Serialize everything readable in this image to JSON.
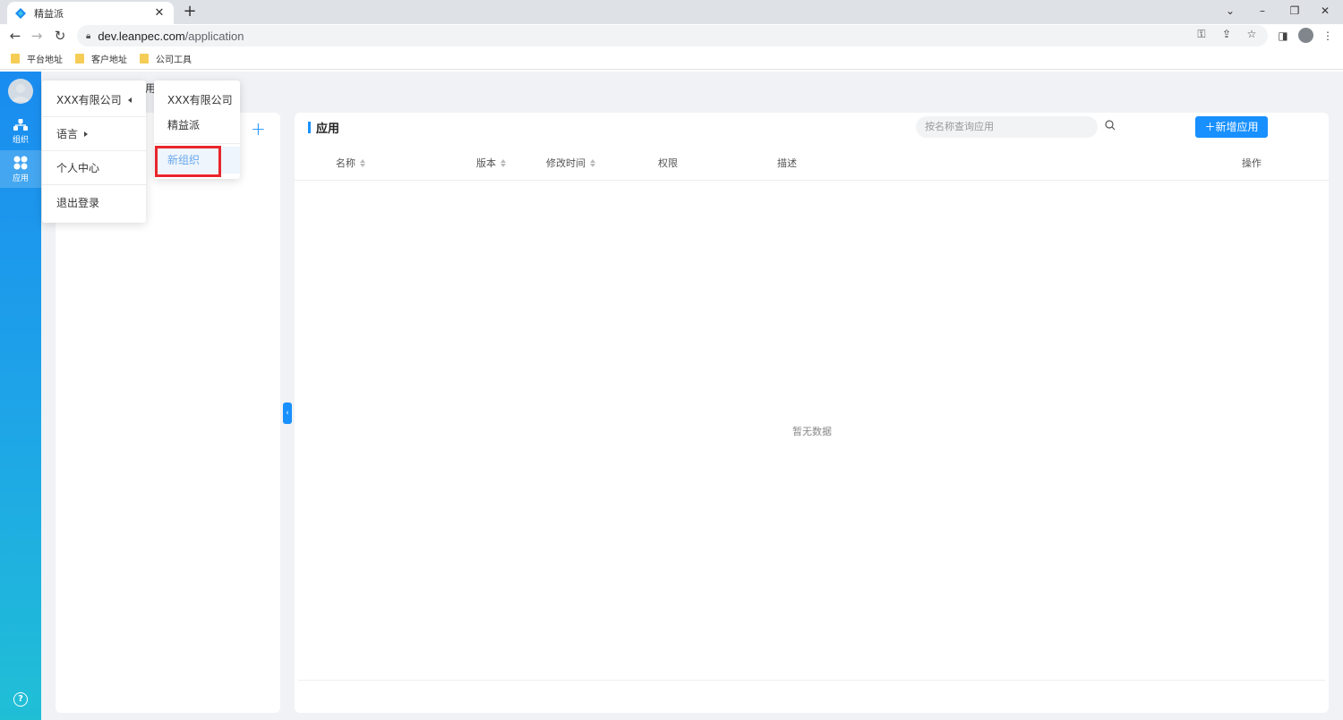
{
  "browser": {
    "tab_title": "精益派",
    "url_host": "dev.leanpec.com",
    "url_path": "/application",
    "bookmarks": [
      "平台地址",
      "客户地址",
      "公司工具"
    ]
  },
  "sidenav": {
    "items": [
      {
        "label": "组织",
        "icon": "org-tree-icon"
      },
      {
        "label": "应用",
        "icon": "apps-icon"
      }
    ],
    "help_icon": "?"
  },
  "org_panel": {
    "peek_text": "用",
    "add_icon": "+"
  },
  "main": {
    "title": "应用",
    "search_placeholder": "按名称查询应用",
    "add_button": "＋新增应用",
    "columns": [
      {
        "label": "名称",
        "sortable": true
      },
      {
        "label": "版本",
        "sortable": true
      },
      {
        "label": "修改时间",
        "sortable": true
      },
      {
        "label": "权限",
        "sortable": false
      },
      {
        "label": "描述",
        "sortable": false
      },
      {
        "label": "操作",
        "sortable": false
      }
    ],
    "empty_text": "暂无数据"
  },
  "user_menu": {
    "items": [
      {
        "label": "XXX有限公司",
        "caret": "left"
      },
      {
        "label": "语言",
        "caret": "right"
      },
      {
        "label": "个人中心"
      },
      {
        "label": "退出登录"
      }
    ]
  },
  "org_submenu": {
    "items": [
      "XXX有限公司",
      "精益派"
    ],
    "new_org": "新组织"
  },
  "colors": {
    "accent": "#1890ff",
    "highlight": "#e8262c"
  }
}
